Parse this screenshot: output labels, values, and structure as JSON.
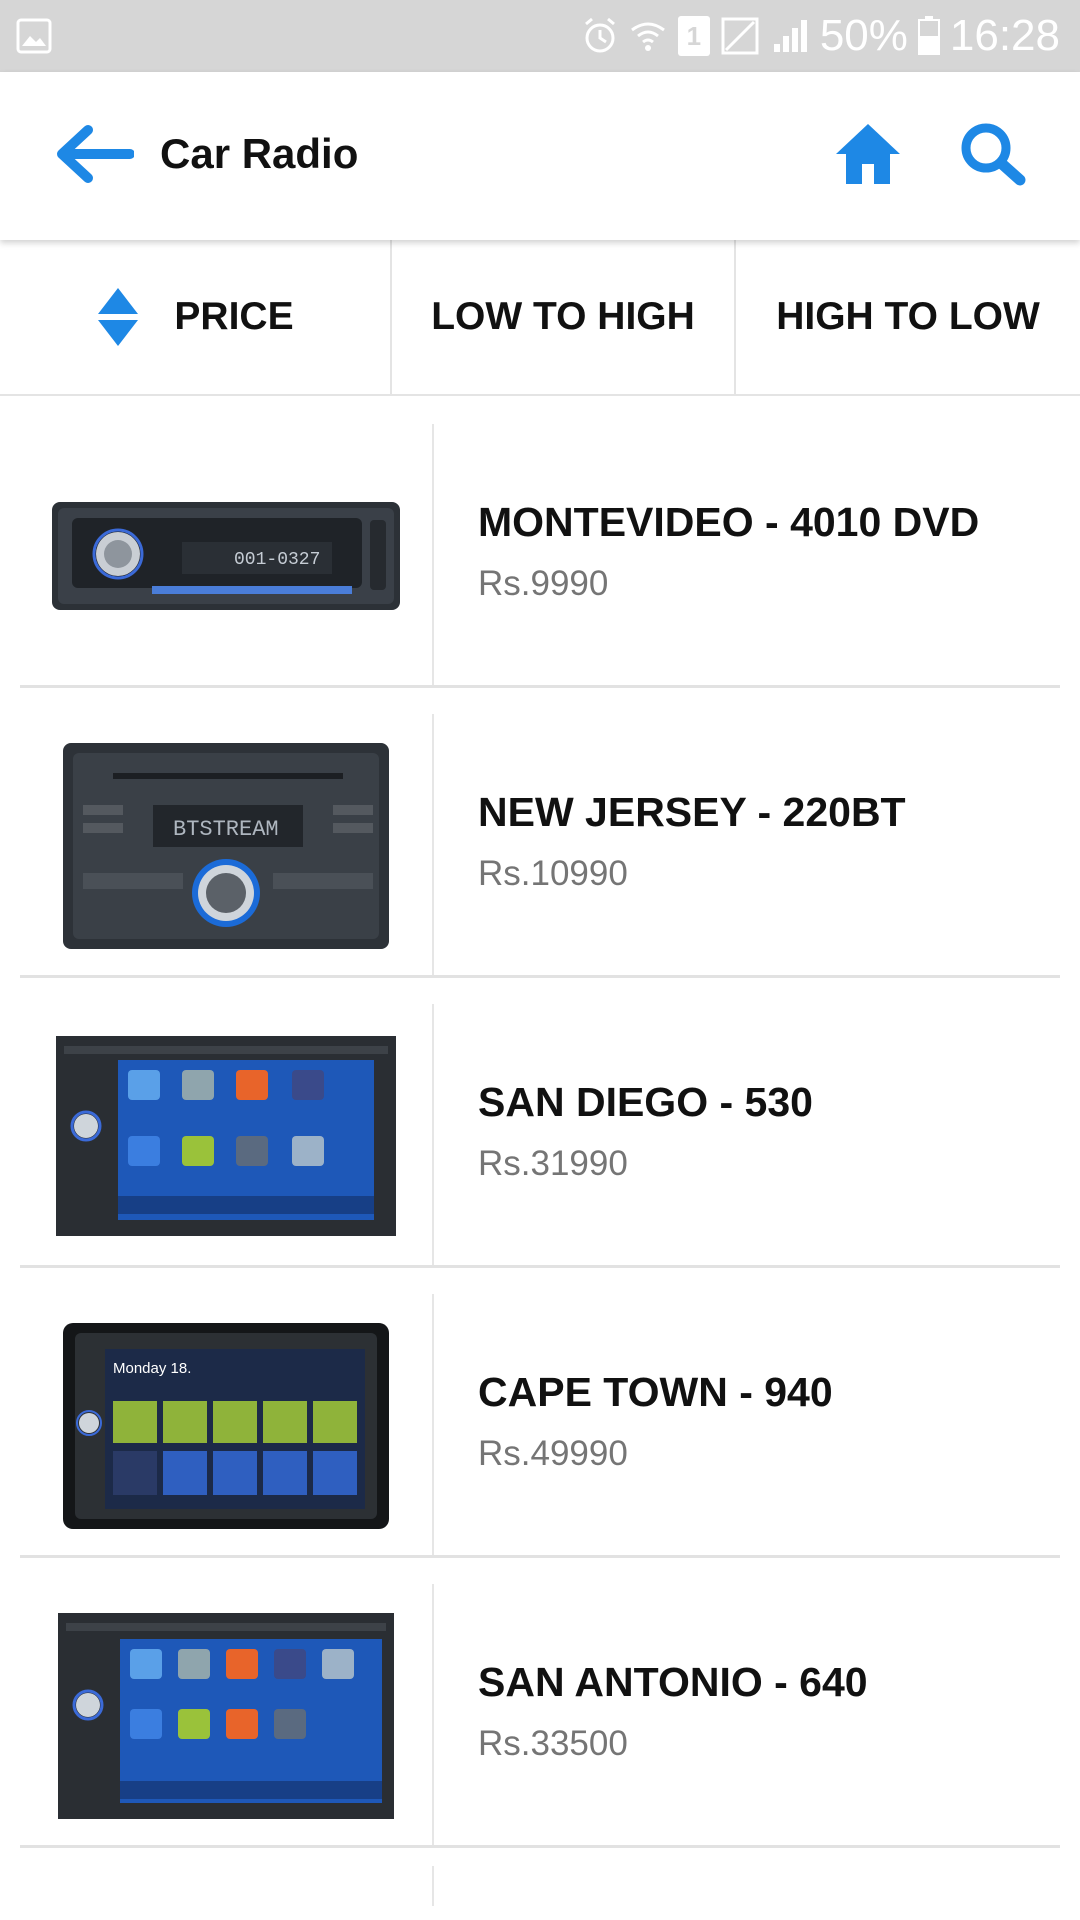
{
  "status_bar": {
    "battery": "50%",
    "time": "16:28",
    "sim_slot": "1",
    "icons": [
      "gallery-icon",
      "alarm-icon",
      "wifi-icon",
      "sim-icon",
      "no-signal-icon",
      "signal-icon",
      "battery-icon"
    ]
  },
  "app_bar": {
    "title": "Car Radio",
    "icons": [
      "back-arrow-icon",
      "home-icon",
      "search-icon"
    ],
    "accent_color": "#1e88e5"
  },
  "sort_bar": {
    "price_label": "PRICE",
    "low_to_high_label": "LOW TO HIGH",
    "high_to_low_label": "HIGH TO LOW",
    "icon": "sort-up-down-icon"
  },
  "products": [
    {
      "name": "MONTEVIDEO - 4010 DVD",
      "price": "Rs.9990"
    },
    {
      "name": "NEW JERSEY - 220BT",
      "price": "Rs.10990"
    },
    {
      "name": "SAN DIEGO - 530",
      "price": "Rs.31990"
    },
    {
      "name": "CAPE TOWN - 940",
      "price": "Rs.49990"
    },
    {
      "name": "SAN ANTONIO - 640",
      "price": "Rs.33500"
    }
  ],
  "product_images": {
    "0_display": "001-0327",
    "1_display": "BTSTREAM",
    "3_day": "Monday 18."
  }
}
